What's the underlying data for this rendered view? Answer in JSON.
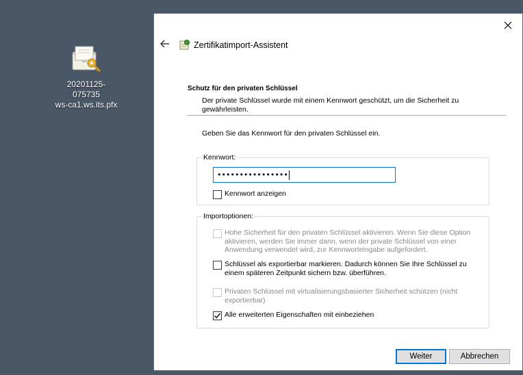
{
  "desktop": {
    "file_icon": "certificate-file-icon",
    "file_name_line1": "20201125-075735",
    "file_name_line2": "ws-ca1.ws.its.pfx"
  },
  "dialog": {
    "title": "Zertifikatimport-Assistent",
    "close_icon": "close-icon",
    "back_icon": "back-arrow-icon",
    "section_heading": "Schutz für den privaten Schlüssel",
    "section_description": "Der private Schlüssel wurde mit einem Kennwort geschützt, um die Sicherheit zu gewährleisten.",
    "instruction": "Geben Sie das Kennwort für den privaten Schlüssel ein.",
    "password_group": {
      "legend": "Kennwort:",
      "value": "••••••••••••••••",
      "show_password_label": "Kennwort anzeigen",
      "show_password_checked": false
    },
    "import_options": {
      "legend": "Importoptionen:",
      "options": [
        {
          "label": "Hohe Sicherheit für den privaten Schlüssel aktivieren. Wenn Sie diese Option aktivieren, werden Sie immer dann, wenn der private Schlüssel von einer Anwendung verwendet wird, zur Kennworteingabe aufgefordert.",
          "checked": false,
          "enabled": false
        },
        {
          "label": "Schlüssel als exportierbar markieren. Dadurch können Sie Ihre Schlüssel zu einem späteren Zeitpunkt sichern bzw. überführen.",
          "checked": false,
          "enabled": true
        },
        {
          "label": "Privaten Schlüssel mit virtualisierungsbasierter Sicherheit schützen (nicht exportierbar)",
          "checked": false,
          "enabled": false
        },
        {
          "label": "Alle erweiterten Eigenschaften mit einbeziehen",
          "checked": true,
          "enabled": true
        }
      ]
    },
    "buttons": {
      "next": "Weiter",
      "cancel": "Abbrechen"
    }
  },
  "colors": {
    "desktop_bg": "#4a5767",
    "accent": "#0078d7"
  }
}
